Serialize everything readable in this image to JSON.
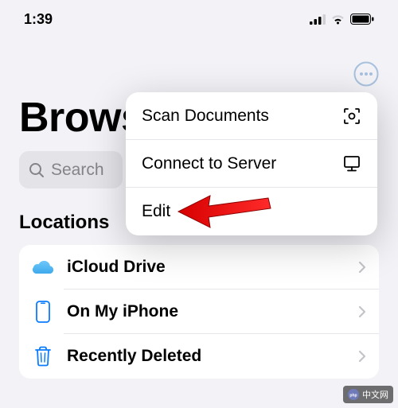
{
  "status_bar": {
    "time": "1:39"
  },
  "page": {
    "title": "Browse"
  },
  "search": {
    "placeholder": "Search"
  },
  "section": {
    "locations_title": "Locations"
  },
  "locations": {
    "items": [
      {
        "label": "iCloud Drive"
      },
      {
        "label": "On My iPhone"
      },
      {
        "label": "Recently Deleted"
      }
    ]
  },
  "context_menu": {
    "items": [
      {
        "label": "Scan Documents"
      },
      {
        "label": "Connect to Server"
      },
      {
        "label": "Edit"
      }
    ]
  },
  "watermark": {
    "text": "中文网"
  }
}
